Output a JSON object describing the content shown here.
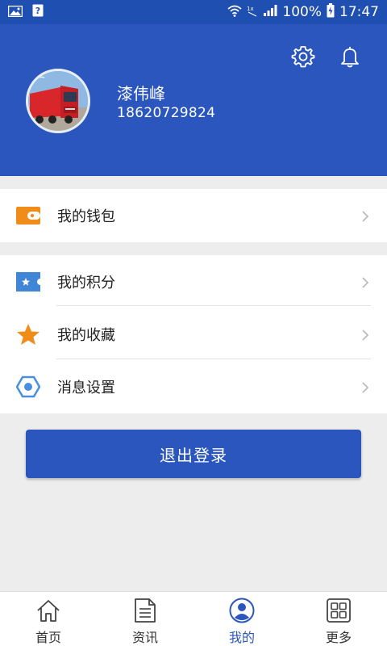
{
  "status_bar": {
    "battery": "100%",
    "time": "17:47",
    "icons": [
      "gallery-icon",
      "unknown-icon",
      "wifi-icon",
      "no-sim-icon",
      "signal-icon",
      "battery-icon"
    ]
  },
  "header": {
    "user_name": "漆伟峰",
    "phone": "18620729824",
    "icons": [
      "settings-gear-icon",
      "notification-bell-icon"
    ]
  },
  "menu": {
    "wallet": {
      "label": "我的钱包",
      "icon": "wallet-icon",
      "icon_color": "#f08c1a"
    },
    "points": {
      "label": "我的积分",
      "icon": "points-ticket-icon",
      "icon_color": "#3f86d6"
    },
    "favorites": {
      "label": "我的收藏",
      "icon": "star-icon",
      "icon_color": "#f08c1a"
    },
    "message_settings": {
      "label": "消息设置",
      "icon": "hexagon-settings-icon",
      "icon_color": "#4a8ee0"
    }
  },
  "logout": {
    "label": "退出登录"
  },
  "bottom_nav": {
    "items": [
      {
        "label": "首页",
        "icon": "home-icon"
      },
      {
        "label": "资讯",
        "icon": "news-document-icon"
      },
      {
        "label": "我的",
        "icon": "user-profile-icon",
        "active": true
      },
      {
        "label": "更多",
        "icon": "more-grid-icon"
      }
    ]
  },
  "colors": {
    "primary": "#2a56bd",
    "status_bar": "#1f4fb0",
    "background": "#ededed",
    "accent_orange": "#f08c1a"
  }
}
